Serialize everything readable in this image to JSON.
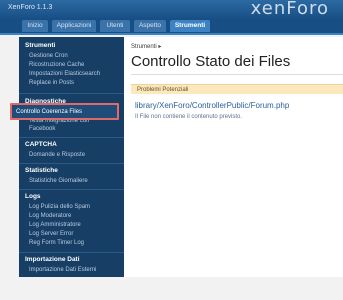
{
  "header": {
    "app_title": "XenForo 1.1.3",
    "logo_text": "xenForo"
  },
  "tabs": [
    {
      "label": "Inizio"
    },
    {
      "label": "Applicazioni"
    },
    {
      "label": "Utenti"
    },
    {
      "label": "Aspetto"
    },
    {
      "label": "Strumenti",
      "active": true
    }
  ],
  "sidebar": {
    "sections": [
      {
        "heading": "Strumenti",
        "items": [
          "Gestione Cron",
          "Ricostruzione Cache",
          "Impostazioni Elasticsearch",
          "Replace in Posts"
        ]
      },
      {
        "heading": "Diagnostiche",
        "items": [
          "Controllo Coerenza Files",
          "Testa Integrazione con",
          "Facebook"
        ]
      },
      {
        "heading": "CAPTCHA",
        "items": [
          "Domande e Risposte"
        ]
      },
      {
        "heading": "Statistiche",
        "items": [
          "Statistiche Giornaliere"
        ]
      },
      {
        "heading": "Logs",
        "items": [
          "Log Pulizia dello Spam",
          "Log Moderatore",
          "Log Amministratore",
          "Log Server Error",
          "Reg Form Timer Log"
        ]
      },
      {
        "heading": "Importazione Dati",
        "items": [
          "Importazione Dati Esterni"
        ]
      }
    ]
  },
  "main": {
    "breadcrumb": "Strumenti ▸",
    "title": "Controllo Stato dei Files",
    "issues_heading": "Problemi Potenziali",
    "file_path": "library/XenForo/ControllerPublic/Forum.php",
    "file_message": "Il File non contiene il contenuto previsto."
  },
  "colors": {
    "header": "#2c6aa3",
    "sidebar": "#173f66",
    "highlight": "#e06a6a",
    "issues_bg": "#fbe8be"
  }
}
